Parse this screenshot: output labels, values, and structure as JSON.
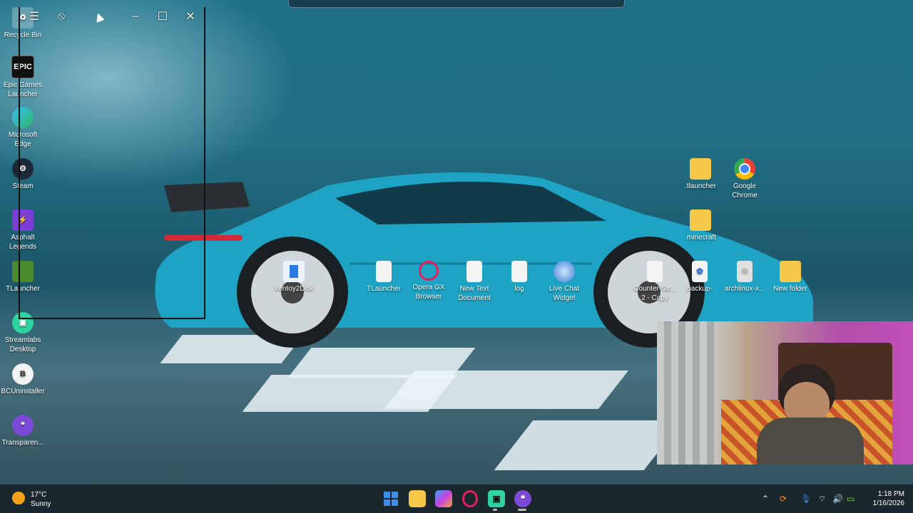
{
  "desktop": {
    "left_icons": [
      {
        "label": "Recycle Bin",
        "icon": "recycle-bin-icon"
      },
      {
        "label": "Epic Games Launcher",
        "icon": "epic-games-icon"
      },
      {
        "label": "Microsoft Edge",
        "icon": "edge-icon"
      },
      {
        "label": "Steam",
        "icon": "steam-icon"
      },
      {
        "label": "Asphalt Legends",
        "icon": "asphalt-icon"
      },
      {
        "label": "TLauncher",
        "icon": "tlauncher-icon"
      },
      {
        "label": "Streamlabs Desktop",
        "icon": "streamlabs-icon"
      },
      {
        "label": "BCUninstaller",
        "icon": "bcuninstaller-icon"
      },
      {
        "label": "Transparen...",
        "icon": "transparent-icon"
      }
    ],
    "right_icons": [
      {
        "label": ".tlauncher",
        "icon": "folder-icon"
      },
      {
        "label": "Google Chrome",
        "icon": "chrome-icon"
      },
      {
        "label": ".minecraft",
        "icon": "folder-icon"
      }
    ],
    "row_icons": [
      {
        "label": "Ventoy2Disk",
        "icon": "ventoy-icon"
      },
      {
        "label": "TLauncher",
        "icon": "file-icon"
      },
      {
        "label": "Opera GX Browser",
        "icon": "opera-gx-icon"
      },
      {
        "label": "New Text Document",
        "icon": "text-file-icon"
      },
      {
        "label": "log",
        "icon": "text-file-icon"
      },
      {
        "label": "Live Chat Widget",
        "icon": "globe-icon"
      },
      {
        "label": "Counter-Str... 2 - Copy",
        "icon": "file-icon"
      },
      {
        "label": "backup-",
        "icon": "backup-icon"
      },
      {
        "label": "archlinux-x...",
        "icon": "disc-icon"
      },
      {
        "label": "New folder",
        "icon": "folder-icon"
      }
    ]
  },
  "weather": {
    "temp": "17°C",
    "condition": "Sunny"
  },
  "clock": {
    "time": "1:18 PM",
    "date": "1/16/2026"
  },
  "colors": {
    "folder": "#f5c84a",
    "accent": "#3d8ee8"
  }
}
